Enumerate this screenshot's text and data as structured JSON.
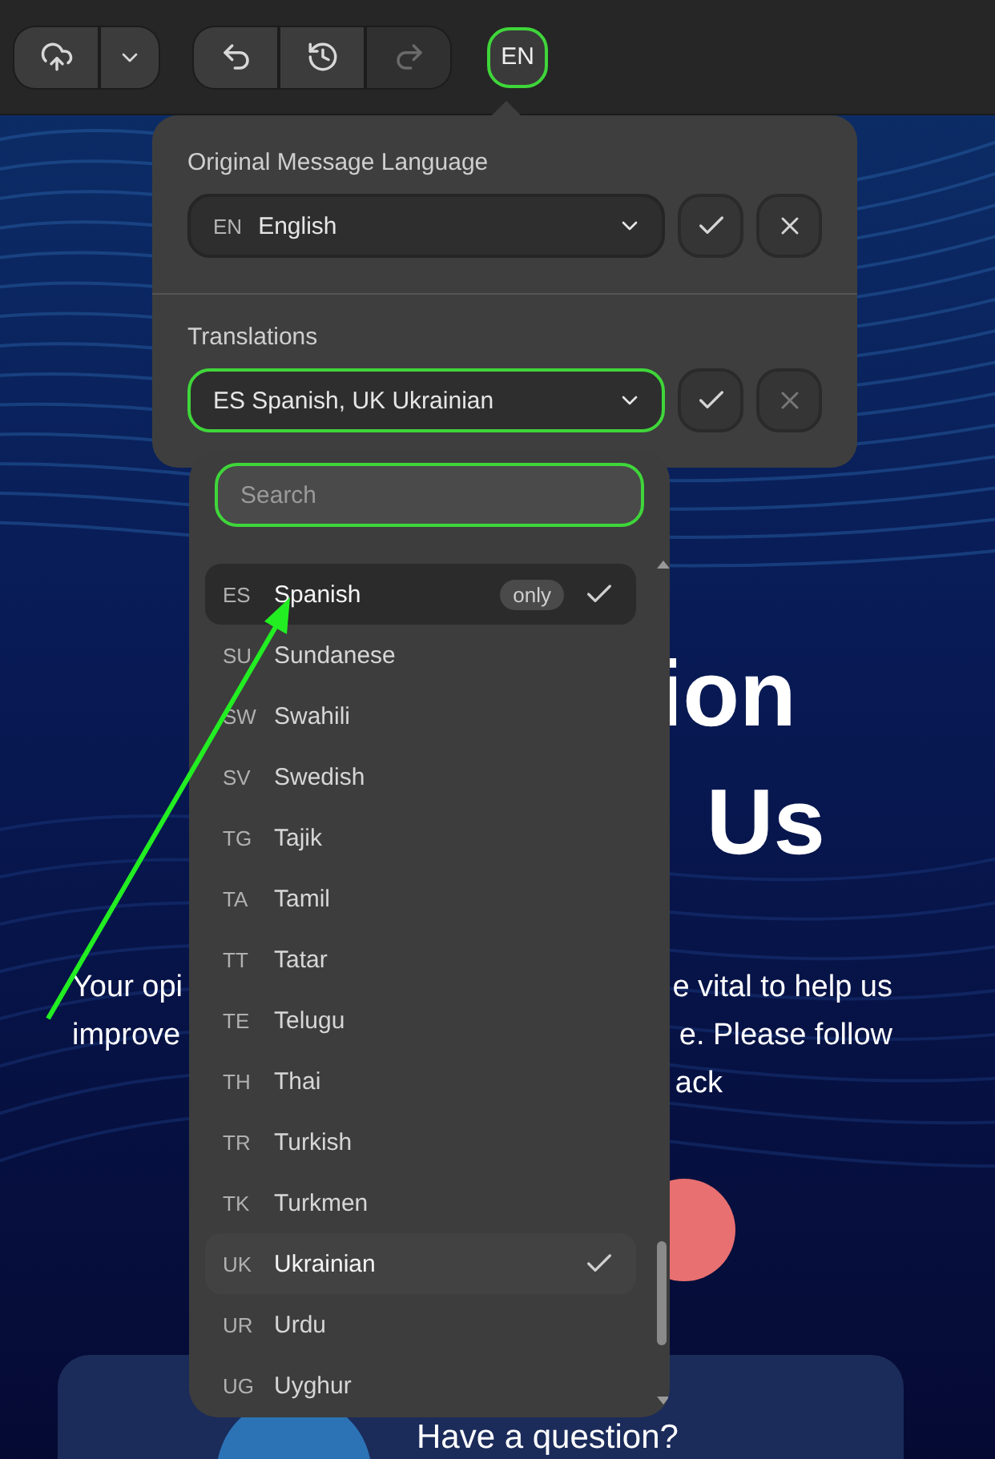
{
  "toolbar": {
    "groups": [
      [
        {
          "kind": "upload",
          "disabled": false
        },
        {
          "kind": "chevron",
          "disabled": false
        }
      ],
      [
        {
          "kind": "undo",
          "disabled": false
        },
        {
          "kind": "history",
          "disabled": false
        },
        {
          "kind": "redo",
          "disabled": true
        }
      ]
    ],
    "language_button": {
      "label": "EN",
      "selected": true
    }
  },
  "popover": {
    "original": {
      "label": "Original Message Language",
      "code": "EN",
      "value": "English",
      "focused": false,
      "confirm_disabled": false,
      "clear_disabled": false
    },
    "translations": {
      "label": "Translations",
      "value": "ES Spanish, UK Ukrainian",
      "focused": true,
      "confirm_disabled": false,
      "clear_disabled": true
    }
  },
  "dropdown": {
    "search": {
      "placeholder": "Search",
      "focused": true
    },
    "items": [
      {
        "code": "ES",
        "name": "Spanish",
        "selected": true,
        "highlighted": true,
        "badge": "only"
      },
      {
        "code": "SU",
        "name": "Sundanese",
        "selected": false,
        "highlighted": false
      },
      {
        "code": "SW",
        "name": "Swahili",
        "selected": false,
        "highlighted": false
      },
      {
        "code": "SV",
        "name": "Swedish",
        "selected": false,
        "highlighted": false
      },
      {
        "code": "TG",
        "name": "Tajik",
        "selected": false,
        "highlighted": false
      },
      {
        "code": "TA",
        "name": "Tamil",
        "selected": false,
        "highlighted": false
      },
      {
        "code": "TT",
        "name": "Tatar",
        "selected": false,
        "highlighted": false
      },
      {
        "code": "TE",
        "name": "Telugu",
        "selected": false,
        "highlighted": false
      },
      {
        "code": "TH",
        "name": "Thai",
        "selected": false,
        "highlighted": false
      },
      {
        "code": "TR",
        "name": "Turkish",
        "selected": false,
        "highlighted": false
      },
      {
        "code": "TK",
        "name": "Turkmen",
        "selected": false,
        "highlighted": false
      },
      {
        "code": "UK",
        "name": "Ukrainian",
        "selected": true,
        "highlighted": false
      },
      {
        "code": "UR",
        "name": "Urdu",
        "selected": false,
        "highlighted": false
      },
      {
        "code": "UG",
        "name": "Uyghur",
        "selected": false,
        "highlighted": false
      }
    ]
  },
  "page": {
    "heading_lines": [
      "ion",
      "Us"
    ],
    "paragraph_lines": [
      {
        "left": "Your opi",
        "right": "e vital to help us"
      },
      {
        "left": "improve",
        "right": "e. Please follow"
      },
      {
        "right": "ack"
      }
    ],
    "card": {
      "title": "Have a question?"
    }
  }
}
